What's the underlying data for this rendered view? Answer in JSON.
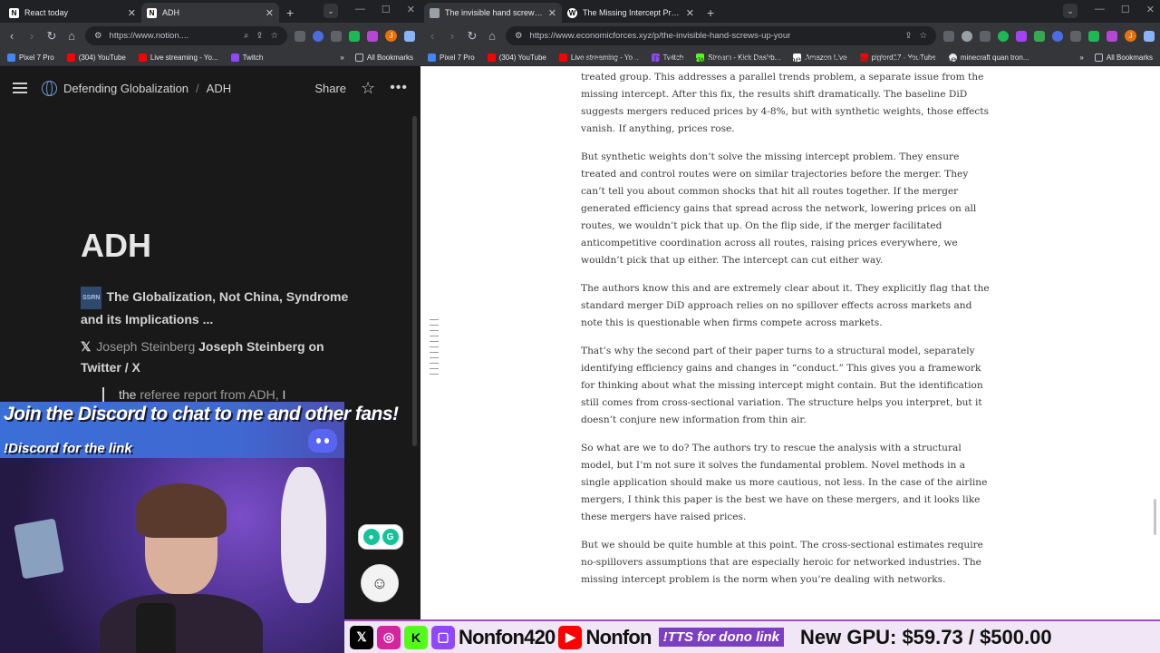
{
  "left_browser": {
    "tabs": [
      {
        "title": "React today",
        "active": false
      },
      {
        "title": "ADH",
        "active": true
      }
    ],
    "url": "https://www.notion....",
    "bookmarks": [
      "Pixel 7 Pro",
      "(304) YouTube",
      "Live streaming - Yo...",
      "Twitch"
    ],
    "bookmarks_more": "»",
    "all_bookmarks": "All Bookmarks"
  },
  "right_browser": {
    "tabs": [
      {
        "title": "The invisible hand screws up your",
        "active": true
      },
      {
        "title": "The Missing Intercept Problem",
        "active": false
      }
    ],
    "url": "https://www.economicforces.xyz/p/the-invisible-hand-screws-up-your",
    "bookmarks": [
      "Pixel 7 Pro",
      "(304) YouTube",
      "Live streaming - Yo...",
      "Twitch",
      "Stream - Kick Dashb...",
      "Amazon Live",
      "piglord17 - YouTube",
      "minecraft quan tron..."
    ],
    "all_bookmarks": "All Bookmarks"
  },
  "notion": {
    "breadcrumb_workspace": "Defending Globalization",
    "breadcrumb_separator": "/",
    "breadcrumb_page": "ADH",
    "share_label": "Share",
    "page_title": "ADH",
    "link1_badge": "SSRN",
    "link1_text": "The Globalization, Not China, Syndrome and its Implications ...",
    "link2_prefix": "Joseph Steinberg",
    "link2_text": "Joseph Steinberg on Twitter / X",
    "quote_start": "the",
    "quote_muted": "referee report from ADH,",
    "quote_end": "I"
  },
  "overlay": {
    "banner_line1": "Join the Discord to chat to me and other fans!",
    "banner_line2": "!Discord for the link"
  },
  "article": {
    "paragraphs": [
      "uses synthetic DiD to reweight controls to better match the pre-trends of the treated group. This addresses a parallel trends problem, a separate issue from the missing intercept. After this fix, the results shift dramatically. The baseline DiD suggests mergers reduced prices by 4-8%, but with synthetic weights, those effects vanish. If anything, prices rose.",
      "But synthetic weights don’t solve the missing intercept problem. They ensure treated and control routes were on similar trajectories before the merger. They can’t tell you about common shocks that hit all routes together. If the merger generated efficiency gains that spread across the network, lowering prices on all routes, we wouldn’t pick that up. On the flip side, if the merger facilitated anticompetitive coordination across all routes, raising prices everywhere, we wouldn’t pick that up either. The intercept can cut either way.",
      "The authors know this and are extremely clear about it. They explicitly flag that the standard merger DiD approach relies on no spillover effects across markets and note this is questionable when firms compete across markets.",
      "That’s why the second part of their paper turns to a structural model, separately identifying efficiency gains and changes in “conduct.” This gives you a framework for thinking about what the missing intercept might contain. But the identification still comes from cross-sectional variation. The structure helps you interpret, but it doesn’t conjure new information from thin air.",
      "So what are we to do? The authors try to rescue the analysis with a structural model, but I’m not sure it solves the fundamental problem. Novel methods in a single application should make us more cautious, not less. In the case of the airline mergers, I think this paper is the best we have on these mergers, and it looks like these mergers have raised prices.",
      "But we should be quite humble at this point. The cross-sectional estimates require no-spillovers assumptions that are especially heroic for networked industries. The missing intercept problem is the norm when you’re dealing with networks."
    ]
  },
  "streambar": {
    "handle1": "Nonfon420",
    "handle2": "Nonfon",
    "dono_label": "!TTS for dono link",
    "goal_text": "New GPU: $59.73 / $500.00"
  },
  "colors": {
    "notion_bg": "#191919",
    "chrome_dark": "#202124",
    "banner_blue": "#3b6fd8",
    "stream_purple": "#a14bd6"
  }
}
